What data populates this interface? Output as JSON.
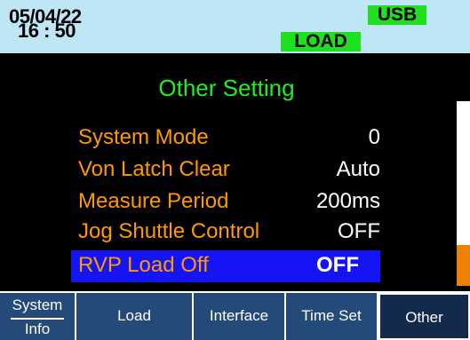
{
  "status": {
    "date": "05/04/22",
    "time": "16 : 50",
    "usb_badge": "USB",
    "load_badge": "LOAD"
  },
  "menu": {
    "title": "Other Setting",
    "rows": [
      {
        "label": "System Mode",
        "value": "0"
      },
      {
        "label": "Von Latch Clear",
        "value": "Auto"
      },
      {
        "label": "Measure Period",
        "value": "200ms"
      },
      {
        "label": "Jog Shuttle Control",
        "value": "OFF"
      },
      {
        "label": "RVP Load Off",
        "value": "OFF"
      }
    ],
    "selected_index": 4
  },
  "softkeys": {
    "system_info_top": "System",
    "system_info_bottom": "Info",
    "load": "Load",
    "interface": "Interface",
    "time_set": "Time Set",
    "other": "Other"
  },
  "colors": {
    "status_bg": "#bfe6f5",
    "badge": "#1fe01f",
    "title": "#22ee22",
    "label": "#ff9900",
    "value": "#ffffff",
    "selected_bg": "#1414f5",
    "softkey_bg": "#244a7a",
    "softkey_active_bg": "#142a4c",
    "scroll_thumb": "#f08000"
  }
}
